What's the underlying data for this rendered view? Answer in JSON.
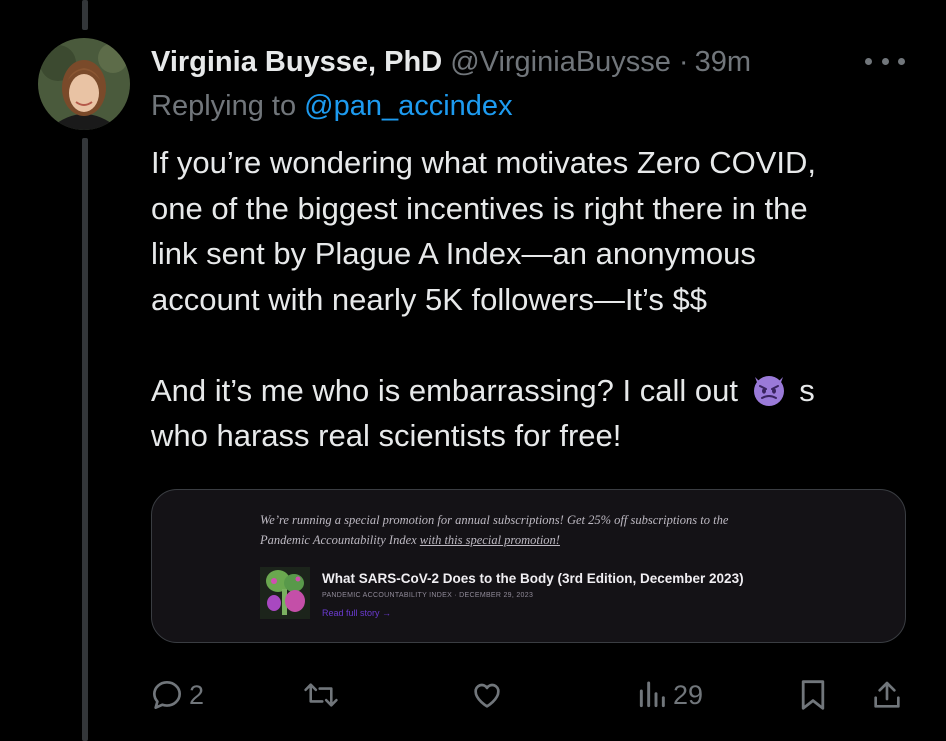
{
  "tweet": {
    "author_name": "Virginia Buysse, PhD",
    "author_handle": "@VirginiaBuysse",
    "separator": "·",
    "timestamp": "39m",
    "replying_prefix": "Replying to ",
    "replying_to": "@pan_accindex",
    "body_lines": [
      "If you’re wondering what motivates Zero COVID,",
      "one of the biggest incentives is right there in the",
      "link sent by Plague A Index—an anonymous",
      "account with nearly 5K followers—It’s $$"
    ],
    "body_line_5_before": "And it’s me who is embarrassing? I call out ",
    "body_line_5_after": " s",
    "body_line_6": "who harass real scientists for free!",
    "emoji_icon": "smiling-imp-emoji"
  },
  "card": {
    "promo_line_1": "We’re running a special promotion for annual subscriptions! Get 25% off subscriptions to the",
    "promo_line_2_text": "Pandemic Accountability Index ",
    "promo_line_2_link": "with this special promotion!",
    "article_title": "What SARS-CoV-2 Does to the Body (3rd Edition, December 2023)",
    "article_meta": "PANDEMIC ACCOUNTABILITY INDEX · DECEMBER 29, 2023",
    "article_link": "Read full story →"
  },
  "actions": {
    "reply_count": "2",
    "retweet_count": "",
    "like_count": "",
    "views_count": "29",
    "icons": [
      "reply-icon",
      "retweet-icon",
      "like-icon",
      "views-icon",
      "bookmark-icon",
      "share-icon"
    ]
  },
  "colors": {
    "background": "#000000",
    "text_primary": "#e7e9ea",
    "text_secondary": "#71767b",
    "link_blue": "#1d9bf0",
    "card_bg": "#141216",
    "card_link_purple": "#6a3ad0"
  }
}
